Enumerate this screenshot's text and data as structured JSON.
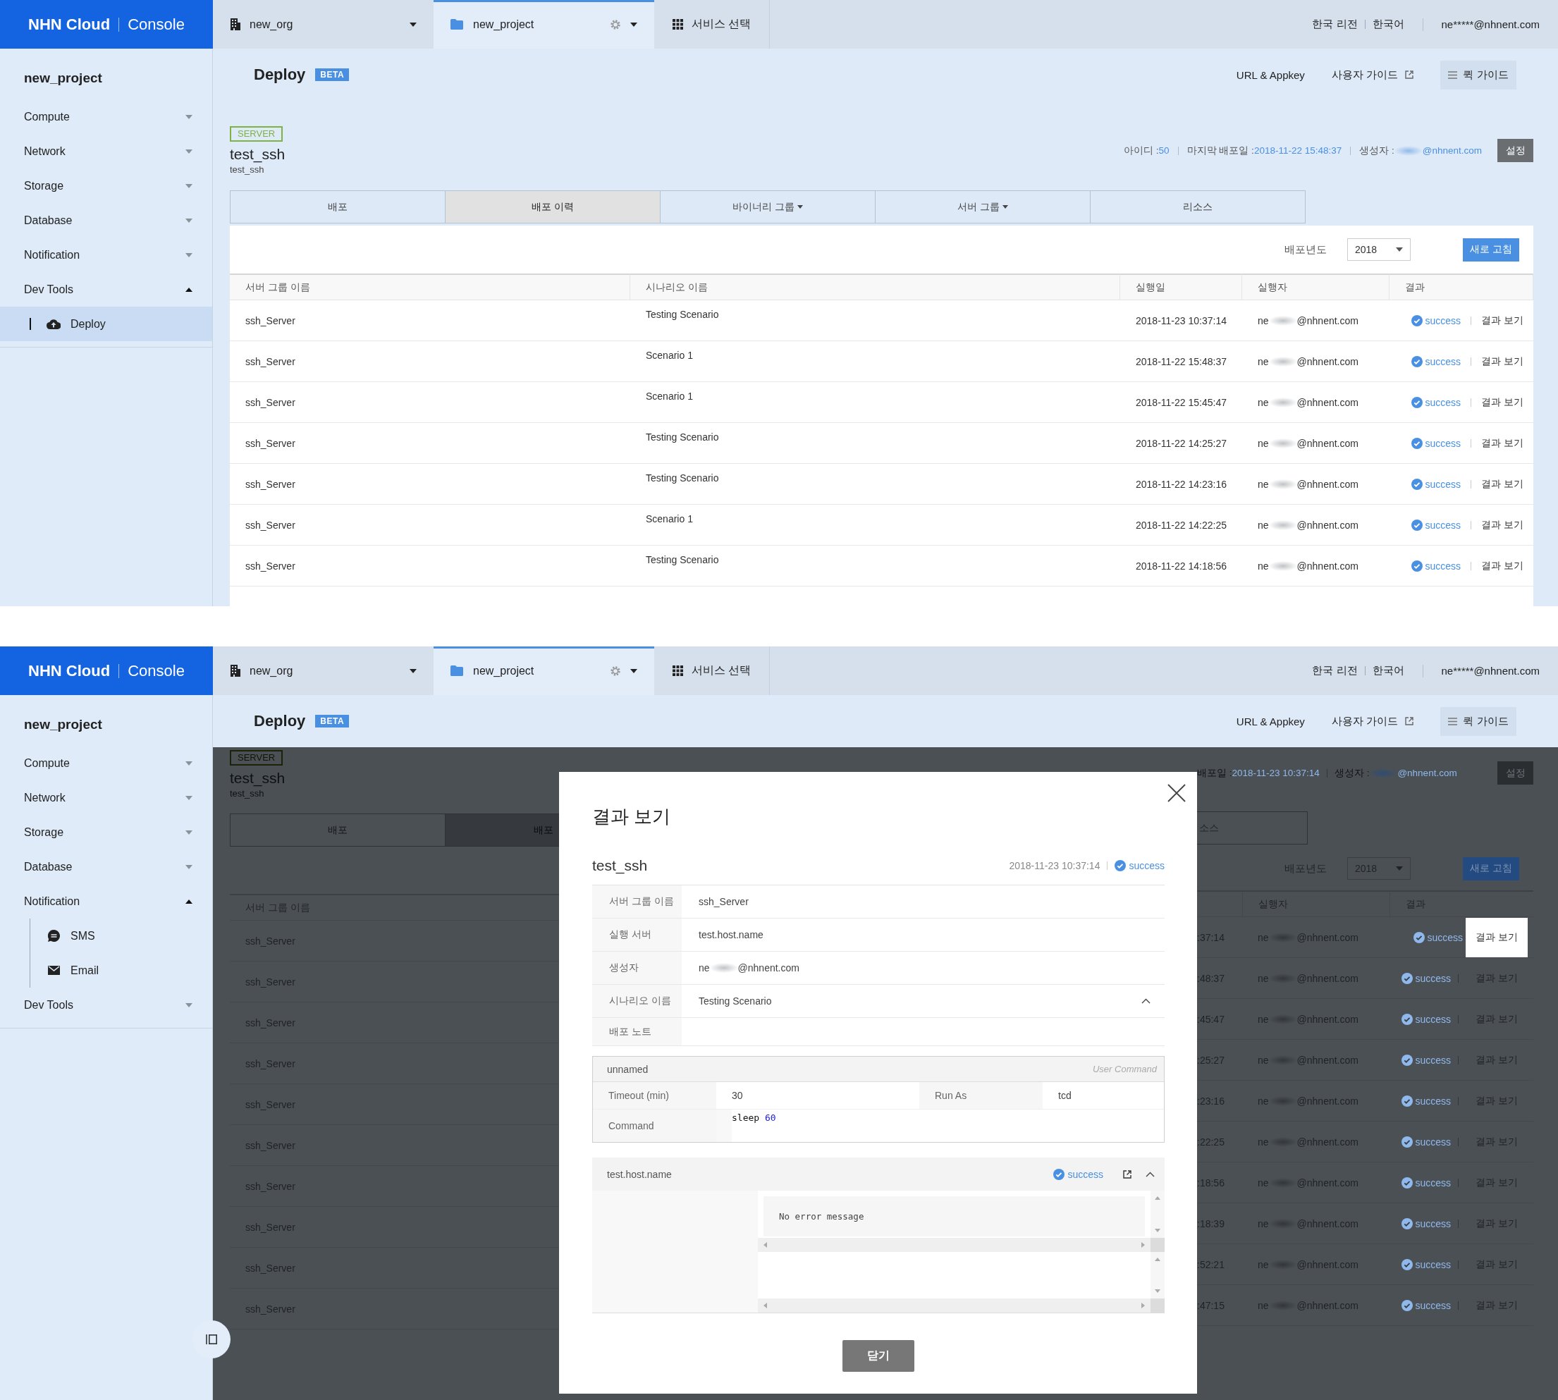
{
  "screenshots": [
    {
      "kind": "history",
      "header": {
        "logo": {
          "brand": "NHN Cloud",
          "product": "Console"
        },
        "organization": "new_org",
        "project": "new_project",
        "services": "서비스 선택",
        "region": "한국 리전",
        "language": "한국어",
        "user": "ne*****@nhnent.com"
      },
      "sidebar": {
        "project": "new_project",
        "items": [
          {
            "label": "Compute",
            "expanded": false
          },
          {
            "label": "Network",
            "expanded": false
          },
          {
            "label": "Storage",
            "expanded": false
          },
          {
            "label": "Database",
            "expanded": false
          },
          {
            "label": "Notification",
            "expanded": false
          },
          {
            "label": "Dev Tools",
            "expanded": true,
            "children": [
              {
                "label": "Deploy",
                "kind": "cloud",
                "selected": true
              }
            ]
          }
        ]
      },
      "page": {
        "title": "Deploy",
        "badge": "BETA",
        "links": [
          "URL & Appkey",
          "사용자 가이드"
        ],
        "quick_guide": "퀵 가이드"
      },
      "detail": {
        "type": "SERVER",
        "name": "test_ssh",
        "description": "test_ssh",
        "meta": [
          {
            "label": "아이디 : ",
            "value": "50",
            "kind": "plain"
          },
          {
            "label": "마지막 배포일 : ",
            "value": "2018-11-22 15:48:37",
            "kind": "plain"
          },
          {
            "label": "생성자 : ",
            "value": "@nhnent.com",
            "kind": "redacted"
          }
        ],
        "settings": "설정"
      },
      "tabs": [
        {
          "label": "배포",
          "selected": false,
          "dropdown": false
        },
        {
          "label": "배포 이력",
          "selected": true,
          "dropdown": false
        },
        {
          "label": "바이너리 그룹",
          "selected": false,
          "dropdown": true
        },
        {
          "label": "서버 그룹",
          "selected": false,
          "dropdown": true
        },
        {
          "label": "리소스",
          "selected": false,
          "dropdown": false
        }
      ],
      "history": {
        "year_label": "배포년도",
        "year": "2018",
        "refresh": "새로 고침",
        "columns": [
          "서버 그룹 이름",
          "시나리오 이름",
          "실행일",
          "실행자",
          "결과"
        ],
        "rows": [
          {
            "group": "ssh_Server",
            "scenario": "Testing Scenario",
            "date": "2018-11-23 10:37:14",
            "executor_start": "ne",
            "executor_end": "@nhnent.com",
            "status": "success",
            "action": "결과 보기"
          },
          {
            "group": "ssh_Server",
            "scenario": "Scenario 1",
            "date": "2018-11-22 15:48:37",
            "executor_start": "ne",
            "executor_end": "@nhnent.com",
            "status": "success",
            "action": "결과 보기"
          },
          {
            "group": "ssh_Server",
            "scenario": "Scenario 1",
            "date": "2018-11-22 15:45:47",
            "executor_start": "ne",
            "executor_end": "@nhnent.com",
            "status": "success",
            "action": "결과 보기"
          },
          {
            "group": "ssh_Server",
            "scenario": "Testing Scenario",
            "date": "2018-11-22 14:25:27",
            "executor_start": "ne",
            "executor_end": "@nhnent.com",
            "status": "success",
            "action": "결과 보기"
          },
          {
            "group": "ssh_Server",
            "scenario": "Testing Scenario",
            "date": "2018-11-22 14:23:16",
            "executor_start": "ne",
            "executor_end": "@nhnent.com",
            "status": "success",
            "action": "결과 보기"
          },
          {
            "group": "ssh_Server",
            "scenario": "Scenario 1",
            "date": "2018-11-22 14:22:25",
            "executor_start": "ne",
            "executor_end": "@nhnent.com",
            "status": "success",
            "action": "결과 보기"
          },
          {
            "group": "ssh_Server",
            "scenario": "Testing Scenario",
            "date": "2018-11-22 14:18:56",
            "executor_start": "ne",
            "executor_end": "@nhnent.com",
            "status": "success",
            "action": "결과 보기"
          }
        ]
      }
    },
    {
      "kind": "result_dialog",
      "header": {
        "logo": {
          "brand": "NHN Cloud",
          "product": "Console"
        },
        "organization": "new_org",
        "project": "new_project",
        "services": "서비스 선택",
        "region": "한국 리전",
        "language": "한국어",
        "user": "ne*****@nhnent.com"
      },
      "sidebar": {
        "project": "new_project",
        "items": [
          {
            "label": "Compute",
            "expanded": false
          },
          {
            "label": "Network",
            "expanded": false
          },
          {
            "label": "Storage",
            "expanded": false
          },
          {
            "label": "Database",
            "expanded": false
          },
          {
            "label": "Notification",
            "expanded": true,
            "children": [
              {
                "label": "SMS",
                "kind": "chat",
                "selected": false
              },
              {
                "label": "Email",
                "kind": "mail",
                "selected": false
              }
            ]
          },
          {
            "label": "Dev Tools",
            "expanded": false
          }
        ]
      },
      "page": {
        "title": "Deploy",
        "badge": "BETA",
        "links": [
          "URL & Appkey",
          "사용자 가이드"
        ],
        "quick_guide": "퀵 가이드"
      },
      "background": {
        "left": {
          "type": "SERVER",
          "name": "test_ssh",
          "description": "test_ssh",
          "tabs": [
            {
              "label": "배포",
              "selected": false
            },
            {
              "label": "배포",
              "selected": true
            }
          ],
          "group_column": "서버 그룹 이름",
          "groups": [
            "ssh_Server",
            "ssh_Server",
            "ssh_Server",
            "ssh_Server",
            "ssh_Server",
            "ssh_Server",
            "ssh_Server",
            "ssh_Server",
            "ssh_Server",
            "ssh_Server"
          ]
        },
        "right": {
          "meta": [
            {
              "label": "배포일 : ",
              "value": "2018-11-23 10:37:14",
              "kind": "plain"
            },
            {
              "label": "생성자 : ",
              "value": "@nhnent.com",
              "kind": "redacted"
            }
          ],
          "settings": "설정",
          "tab": "소스",
          "year_label": "배포년도",
          "year": "2018",
          "refresh": "새로 고침",
          "columns": [
            "실행자",
            "결과"
          ],
          "rows": [
            {
              "date_end": ":37:14",
              "executor_start": "ne",
              "executor_end": "@nhnent.com",
              "status": "success",
              "action": "결과 보기",
              "selected": true
            },
            {
              "date_end": ":48:37",
              "executor_start": "ne",
              "executor_end": "@nhnent.com",
              "status": "success",
              "action": "결과 보기",
              "selected": false
            },
            {
              "date_end": ":45:47",
              "executor_start": "ne",
              "executor_end": "@nhnent.com",
              "status": "success",
              "action": "결과 보기",
              "selected": false
            },
            {
              "date_end": ":25:27",
              "executor_start": "ne",
              "executor_end": "@nhnent.com",
              "status": "success",
              "action": "결과 보기",
              "selected": false
            },
            {
              "date_end": ":23:16",
              "executor_start": "ne",
              "executor_end": "@nhnent.com",
              "status": "success",
              "action": "결과 보기",
              "selected": false
            },
            {
              "date_end": ":22:25",
              "executor_start": "ne",
              "executor_end": "@nhnent.com",
              "status": "success",
              "action": "결과 보기",
              "selected": false
            },
            {
              "date_end": ":18:56",
              "executor_start": "ne",
              "executor_end": "@nhnent.com",
              "status": "success",
              "action": "결과 보기",
              "selected": false
            },
            {
              "date_end": ":18:39",
              "executor_start": "ne",
              "executor_end": "@nhnent.com",
              "status": "success",
              "action": "결과 보기",
              "selected": false
            },
            {
              "date_end": ":52:21",
              "executor_start": "ne",
              "executor_end": "@nhnent.com",
              "status": "success",
              "action": "결과 보기",
              "selected": false
            },
            {
              "date_end": ":47:15",
              "executor_start": "ne",
              "executor_end": "@nhnent.com",
              "status": "success",
              "action": "결과 보기",
              "selected": false
            }
          ]
        }
      },
      "dialog": {
        "title": "결과 보기",
        "name": "test_ssh",
        "date": "2018-11-23 10:37:14",
        "status": "success",
        "fields": [
          {
            "kind": "text",
            "label": "서버 그룹 이름",
            "value": "ssh_Server"
          },
          {
            "kind": "text",
            "label": "실행 서버",
            "value": "test.host.name"
          },
          {
            "kind": "redacted",
            "label": "생성자",
            "value_start": "ne",
            "value_end": "@nhnent.com"
          },
          {
            "kind": "expandable",
            "label": "시나리오 이름",
            "value": "Testing Scenario",
            "expanded": true
          },
          {
            "kind": "empty",
            "label": "배포 노트"
          }
        ],
        "command": {
          "name": "unnamed",
          "type": "User Command",
          "timeout_label": "Timeout (min)",
          "timeout": "30",
          "run_as_label": "Run As",
          "run_as": "tcd",
          "command_label": "Command",
          "tokens": [
            {
              "text": "sleep ",
              "kind": "word"
            },
            {
              "text": "60",
              "kind": "number"
            }
          ]
        },
        "host": {
          "name": "test.host.name",
          "status": "success",
          "expanded": true,
          "output": "No error message"
        },
        "close": "닫기"
      }
    }
  ]
}
